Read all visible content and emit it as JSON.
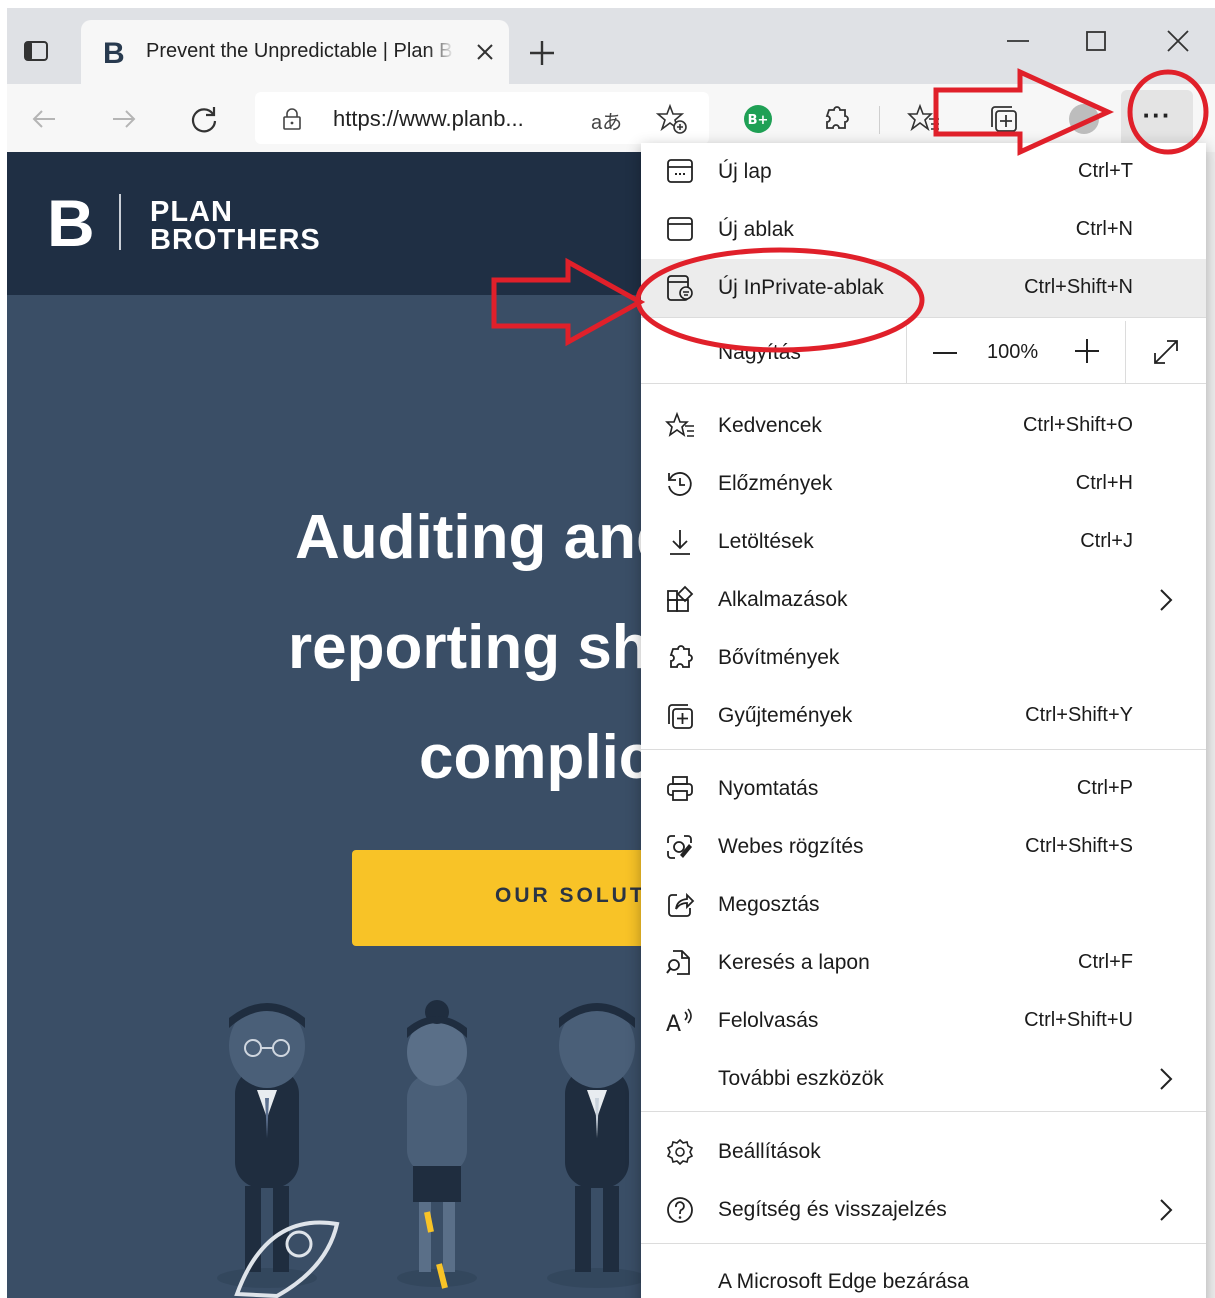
{
  "browser": {
    "tab": {
      "title": "Prevent the Unpredictable | Plan Brothers",
      "favicon_icon": "plan-brothers-b-icon"
    },
    "address": {
      "url": "https://www.planb...",
      "read_aloud_label": "aあ"
    },
    "more_label": "···"
  },
  "page": {
    "logo": {
      "mark": "B",
      "line1": "PLAN",
      "line2": "BROTHERS"
    },
    "hero_lines": [
      "Auditing and",
      "reporting sho",
      "complic"
    ],
    "cta_label": "OUR SOLUTI"
  },
  "menu": {
    "new_tab": {
      "label": "Új lap",
      "shortcut": "Ctrl+T"
    },
    "new_window": {
      "label": "Új ablak",
      "shortcut": "Ctrl+N"
    },
    "new_inprivate": {
      "label": "Új InPrivate-ablak",
      "shortcut": "Ctrl+Shift+N"
    },
    "zoom": {
      "label": "Nagyítás",
      "value": "100%"
    },
    "favorites": {
      "label": "Kedvencek",
      "shortcut": "Ctrl+Shift+O"
    },
    "history": {
      "label": "Előzmények",
      "shortcut": "Ctrl+H"
    },
    "downloads": {
      "label": "Letöltések",
      "shortcut": "Ctrl+J"
    },
    "apps": {
      "label": "Alkalmazások"
    },
    "extensions": {
      "label": "Bővítmények"
    },
    "collections": {
      "label": "Gyűjtemények",
      "shortcut": "Ctrl+Shift+Y"
    },
    "print": {
      "label": "Nyomtatás",
      "shortcut": "Ctrl+P"
    },
    "web_capture": {
      "label": "Webes rögzítés",
      "shortcut": "Ctrl+Shift+S"
    },
    "share": {
      "label": "Megosztás"
    },
    "find": {
      "label": "Keresés a lapon",
      "shortcut": "Ctrl+F"
    },
    "read_aloud": {
      "label": "Felolvasás",
      "shortcut": "Ctrl+Shift+U"
    },
    "more_tools": {
      "label": "További eszközök"
    },
    "settings": {
      "label": "Beállítások"
    },
    "help": {
      "label": "Segítség és visszajelzés"
    },
    "close_edge": {
      "label": "A Microsoft Edge bezárása"
    }
  },
  "colors": {
    "header_bg": "#1f2f44",
    "page_bg": "#3a4e66",
    "cta": "#f8c327",
    "annotation": "#e0202a"
  }
}
